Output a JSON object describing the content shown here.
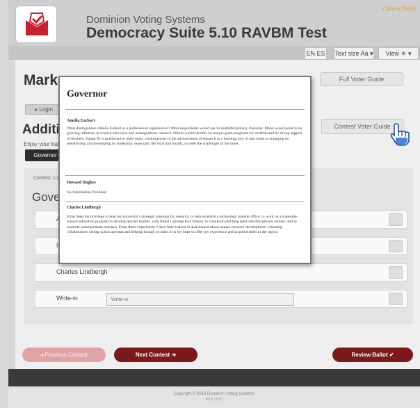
{
  "header": {
    "subtitle": "Dominion Voting Systems",
    "title": "Democracy Suite 5.10 RAVBM Test",
    "corner_link": "Cancel Ballot",
    "lang_button": "EN ES",
    "textsize_button": "Text size Aa",
    "view_button": "View"
  },
  "main": {
    "title": "Mark y",
    "login_button": "Login",
    "additional_heading": "Addition",
    "enjoy_text": "Enjoy your bal",
    "governor_tab": "Governor",
    "full_voter_guide": "Full Voter Guide",
    "contest_voter_guide": "Contest Voter Guide",
    "contest_counter": "Contest: 1 o",
    "contest_heading": "Gover"
  },
  "candidates": [
    {
      "name": "Am"
    },
    {
      "name": "Ho"
    },
    {
      "name": "Charles Lindbergh"
    }
  ],
  "writein": {
    "label": "Write-in",
    "placeholder": "Write-in"
  },
  "nav": {
    "previous": "Previous Contest",
    "next": "Next Contest",
    "next_arrow": "➔",
    "review": "Review Ballot",
    "review_check": "✔"
  },
  "footer": {
    "copyright": "Copyright © 2016 Dominion Voting Systems",
    "version": "RV 5.10.57"
  },
  "popup": {
    "title": "Governor",
    "entries": [
      {
        "name": "Amelia Earhart",
        "text": "What distinguishes Amelia Earhart as a professional organization? Most respondents would say its multidisciplinary character. Many would point to its growing influence in science education and undergraduate research. Others would identify its unique grant programs for students and its strong support of teachers. Sigma Xi is positioned to unite many constituencies in the advancement of research as a learning tool. It also looks to enlarging its membership and developing its leadership, especially the local unit boards, to meet the challenges of the times."
      },
      {
        "name": "Howard Hughes",
        "text": "No Information Provided"
      },
      {
        "name": "Charles Lindbergh",
        "text": "It has been my privilege to lead my university's strategic planning for research, to help establish a technology transfer office, to work on a statewide science education program to develop teacher leaders, with Nobel Laureate Ken Wilson, to champion and help seed interdisciplinary centers, and to promote undergraduate research. From these experiences I have been trained in and learned about human resource development, visioning, collaboration, setting action agendas and helping though on tasks. It is my hope to offer my experience and acquired skills to the region."
      }
    ]
  },
  "colors": {
    "accent": "#7a1a1a",
    "accent_disabled": "#e1a4a4",
    "logo_red": "#c8202f",
    "corner_link": "#e69a3a"
  }
}
